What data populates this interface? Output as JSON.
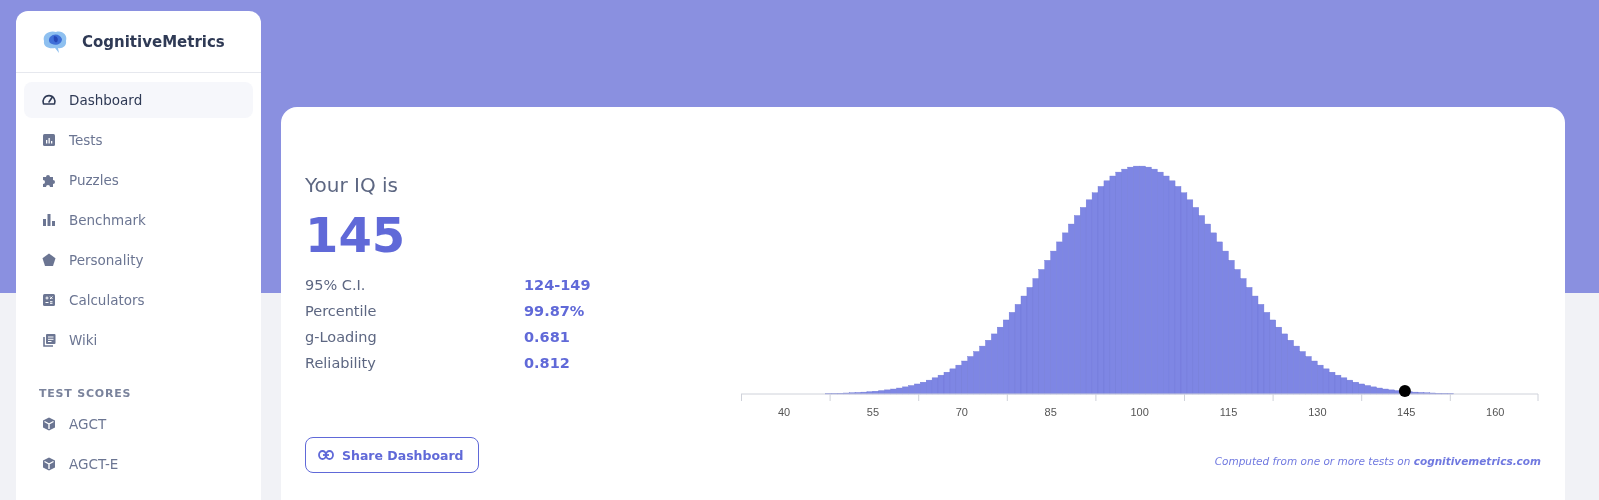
{
  "brand": {
    "name": "CognitiveMetrics"
  },
  "sidebar": {
    "items": [
      {
        "label": "Dashboard",
        "selected": true
      },
      {
        "label": "Tests",
        "selected": false
      },
      {
        "label": "Puzzles",
        "selected": false
      },
      {
        "label": "Benchmark",
        "selected": false
      },
      {
        "label": "Personality",
        "selected": false
      },
      {
        "label": "Calculators",
        "selected": false
      },
      {
        "label": "Wiki",
        "selected": false
      }
    ],
    "section_title": "TEST SCORES",
    "test_scores": [
      {
        "label": "AGCT",
        "selected": false
      },
      {
        "label": "AGCT-E",
        "selected": false
      }
    ]
  },
  "result": {
    "heading": "Your IQ is",
    "score": "145",
    "stats": [
      {
        "label": "95% C.I.",
        "value": "124-149"
      },
      {
        "label": "Percentile",
        "value": "99.87%"
      },
      {
        "label": "g-Loading",
        "value": "0.681"
      },
      {
        "label": "Reliability",
        "value": "0.812"
      }
    ],
    "share_button": "Share Dashboard",
    "distribution": {
      "axis_labels": [
        "40",
        "55",
        "70",
        "85",
        "100",
        "115",
        "130",
        "145",
        "160"
      ],
      "marker": {
        "level": 0.833
      }
    },
    "footer": "Computed from one or more tests on **cognitivemetrics.com**"
  }
}
